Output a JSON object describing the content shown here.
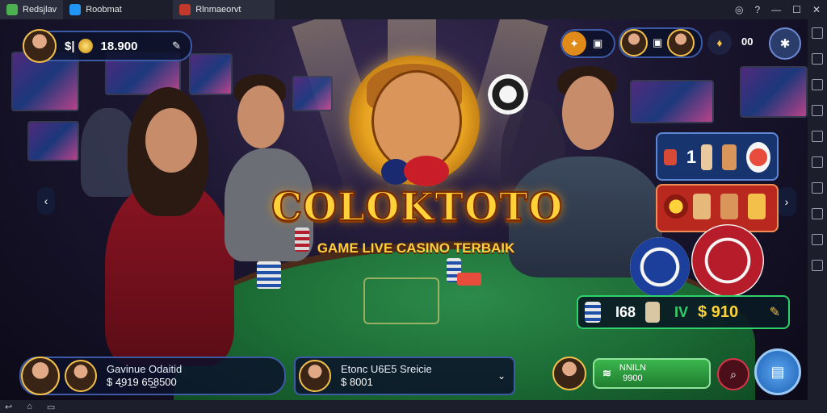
{
  "window": {
    "tabs": [
      {
        "label": "Redsjlav",
        "icon": "app-icon",
        "color": "#4caf50"
      },
      {
        "label": "Roobmat",
        "icon": "store-icon",
        "color": "#2196f3"
      },
      {
        "label": "Rlnmaeorvt",
        "icon": "game-icon",
        "color": "#c0392b"
      }
    ],
    "controls": [
      "settings-icon",
      "help-icon",
      "minimize-icon",
      "maximize-icon",
      "close-icon"
    ]
  },
  "hud": {
    "balance_prefix": "$|",
    "balance_value": "18.900",
    "edit_icon": "pencil-icon",
    "count_label": "00"
  },
  "game": {
    "title": "COLOKTOTO",
    "subtitle": "GAME LIVE CASINO TERBAIK"
  },
  "side_panel": {
    "row1_value": "1",
    "bet_values": [
      "I68",
      "IV",
      "$ 910"
    ]
  },
  "bottom": {
    "player1_name": "Gavinue Odaitid",
    "player1_amount": "$ 4̱919 65̲8500",
    "player2_name": "Etonc U6E5 Sreicie",
    "player2_amount": "$ 8001",
    "action_label": "NNILN",
    "action_amount": "9900"
  },
  "colors": {
    "accent_gold": "#f3c04a",
    "felt_green": "#1b6a34",
    "action_green": "#2f9e3c",
    "navy": "#0c122a"
  }
}
